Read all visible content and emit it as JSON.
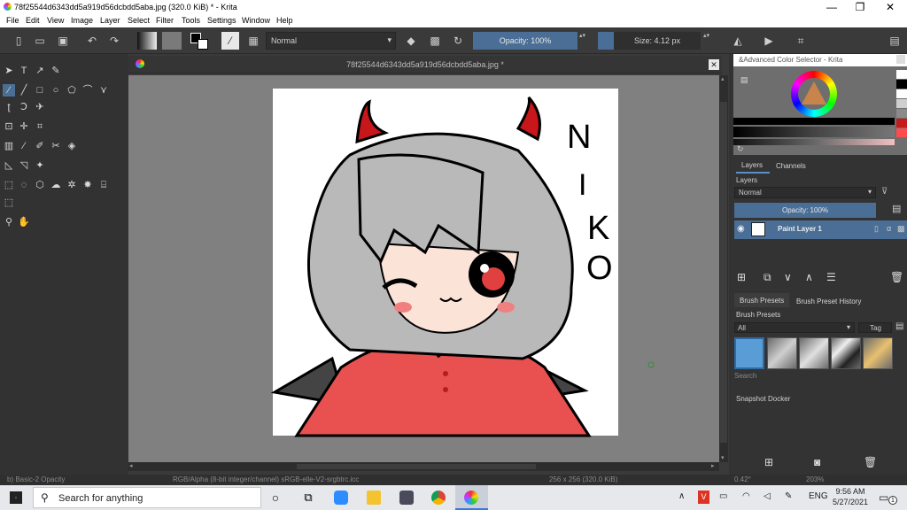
{
  "window": {
    "title": "78f25544d6343dd5a919d56dcbdd5aba.jpg (320.0 KiB)  * - Krita",
    "minimize": "—",
    "restore": "❐",
    "close": "✕"
  },
  "menu": [
    "File",
    "Edit",
    "View",
    "Image",
    "Layer",
    "Select",
    "Filter",
    "Tools",
    "Settings",
    "Window",
    "Help"
  ],
  "toolbar": {
    "blend_mode": "Normal",
    "opacity": "Opacity: 100%",
    "size": "Size: 4.12 px"
  },
  "document": {
    "tab_name": "78f25544d6343dd5a919d56dcbdd5aba.jpg *",
    "canvas_text": [
      "N",
      "I",
      "K",
      "O"
    ]
  },
  "status": {
    "brush": "b) Basic-2 Opacity",
    "color_space": "RGB/Alpha (8-bit integer/channel)  sRGB-elle-V2-srgbtrc.icc",
    "dimensions": "256 x 256 (320.0 KiB)",
    "angle": "0.42°",
    "zoom": "203%"
  },
  "color_selector": {
    "title": "&Advanced Color Selector - Krita"
  },
  "layers_docker": {
    "tabs": [
      "Layers",
      "Channels"
    ],
    "title": "Layers",
    "blend_mode": "Normal",
    "opacity": "Opacity:  100%",
    "layer_name": "Paint Layer 1"
  },
  "brush_presets": {
    "tabs": [
      "Brush Presets",
      "Brush Preset History"
    ],
    "title": "Brush Presets",
    "filter": "All",
    "tag": "Tag",
    "search_placeholder": "Search"
  },
  "snapshot": {
    "title": "Snapshot Docker"
  },
  "taskbar": {
    "search_placeholder": "Search for anything",
    "language": "ENG",
    "time": "9:56 AM",
    "date": "5/27/2021",
    "notifications": "1"
  },
  "colors": {
    "accent": "#4a6e95",
    "hair": "#b9b9b9",
    "shirt": "#e95150",
    "horn": "#c8171b"
  }
}
